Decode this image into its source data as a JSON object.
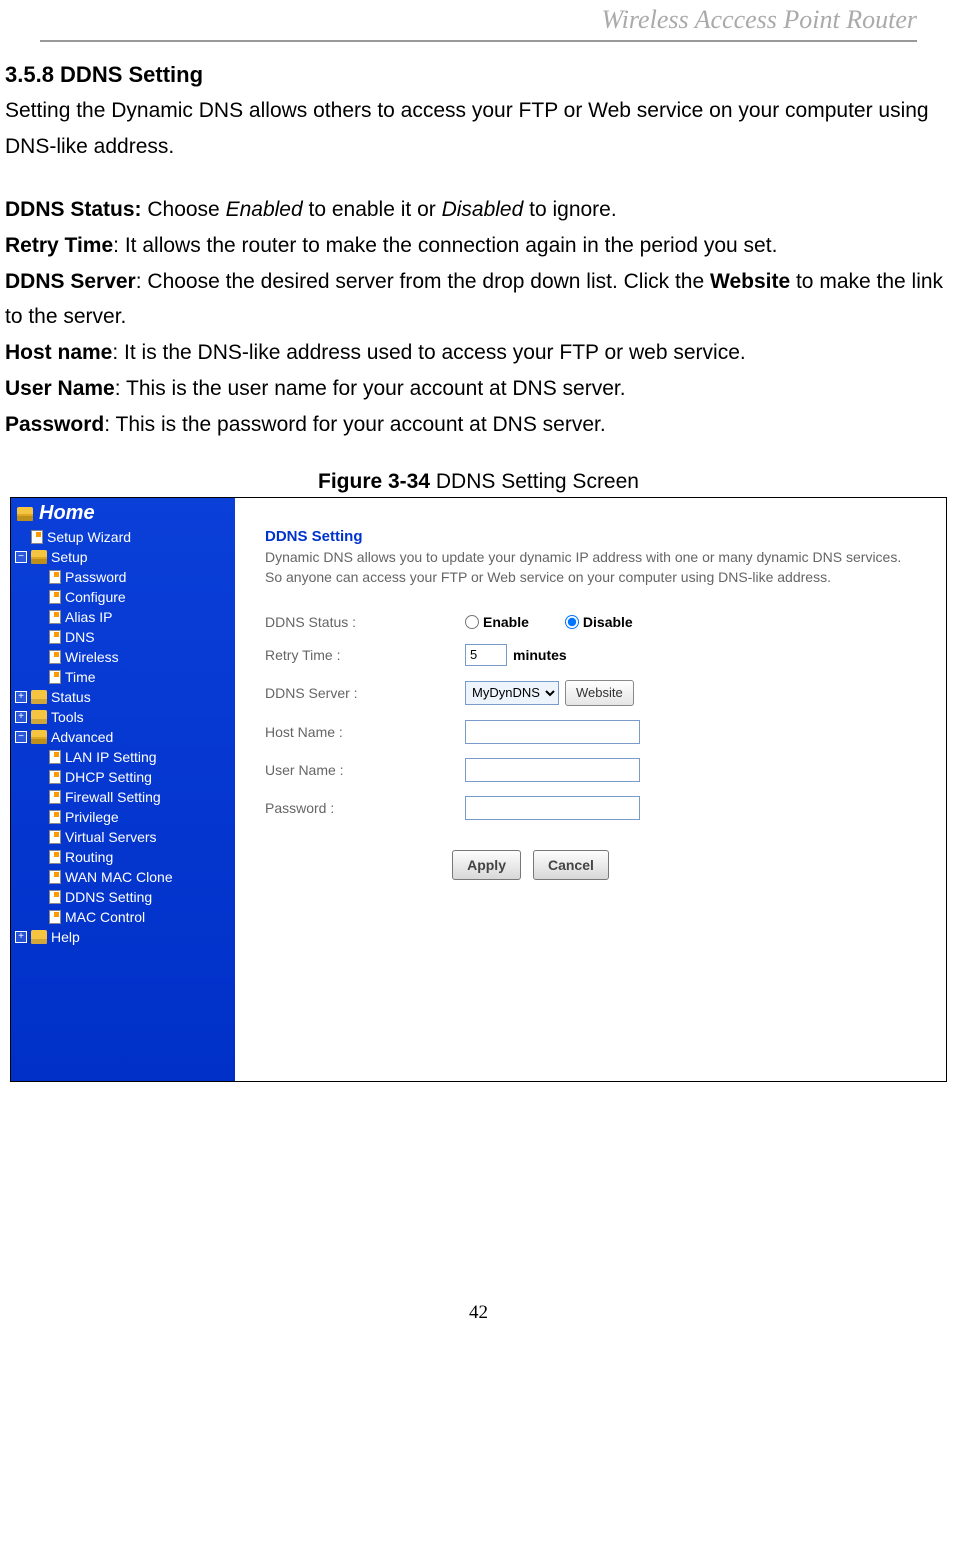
{
  "header": {
    "title": "Wireless  Acccess  Point  Router"
  },
  "doc": {
    "section_no": "3.5.8 DDNS Setting",
    "intro": "Setting the Dynamic DNS allows others to access your FTP or Web service on your computer using DNS-like address.",
    "defs": {
      "status_label": "DDNS Status:",
      "status_text_a": " Choose ",
      "status_enabled": "Enabled",
      "status_text_b": " to enable it or ",
      "status_disabled": "Disabled",
      "status_text_c": " to ignore.",
      "retry_label": "Retry Time",
      "retry_text": ": It allows the router to make the connection again in the period you set.",
      "server_label": "DDNS Server",
      "server_text_a": ": Choose the desired server from the drop down list. Click the ",
      "server_website": "Website",
      "server_text_b": " to make the link to the server.",
      "host_label": "Host name",
      "host_text": ": It is the DNS-like address used to access your FTP or web service.",
      "user_label": "User Name",
      "user_text": ": This is the user name for your account at DNS server.",
      "pass_label": "Password",
      "pass_text": ": This is the password for your account at DNS server."
    },
    "figure_bold": "Figure 3-34",
    "figure_rest": " DDNS Setting Screen",
    "page_number": "42"
  },
  "nav": {
    "home": "Home",
    "setup_wizard": "Setup Wizard",
    "setup": "Setup",
    "setup_items": [
      "Password",
      "Configure",
      "Alias IP",
      "DNS",
      "Wireless",
      "Time"
    ],
    "status": "Status",
    "tools": "Tools",
    "advanced": "Advanced",
    "advanced_items": [
      "LAN IP Setting",
      "DHCP Setting",
      "Firewall Setting",
      "Privilege",
      "Virtual Servers",
      "Routing",
      "WAN MAC Clone",
      "DDNS Setting",
      "MAC Control"
    ],
    "help": "Help"
  },
  "panel": {
    "title": "DDNS Setting",
    "desc": "Dynamic DNS allows you to update your dynamic IP address with one or many dynamic DNS services. So anyone can access your FTP or Web service on your computer using DNS-like address.",
    "labels": {
      "status": "DDNS Status :",
      "retry": "Retry Time :",
      "server": "DDNS Server :",
      "host": "Host Name :",
      "user": "User Name :",
      "pass": "Password :"
    },
    "radio": {
      "enable": "Enable",
      "disable": "Disable"
    },
    "retry_value": "5",
    "minutes": "minutes",
    "server_value": "MyDynDNS",
    "website_btn": "Website",
    "apply": "Apply",
    "cancel": "Cancel"
  }
}
